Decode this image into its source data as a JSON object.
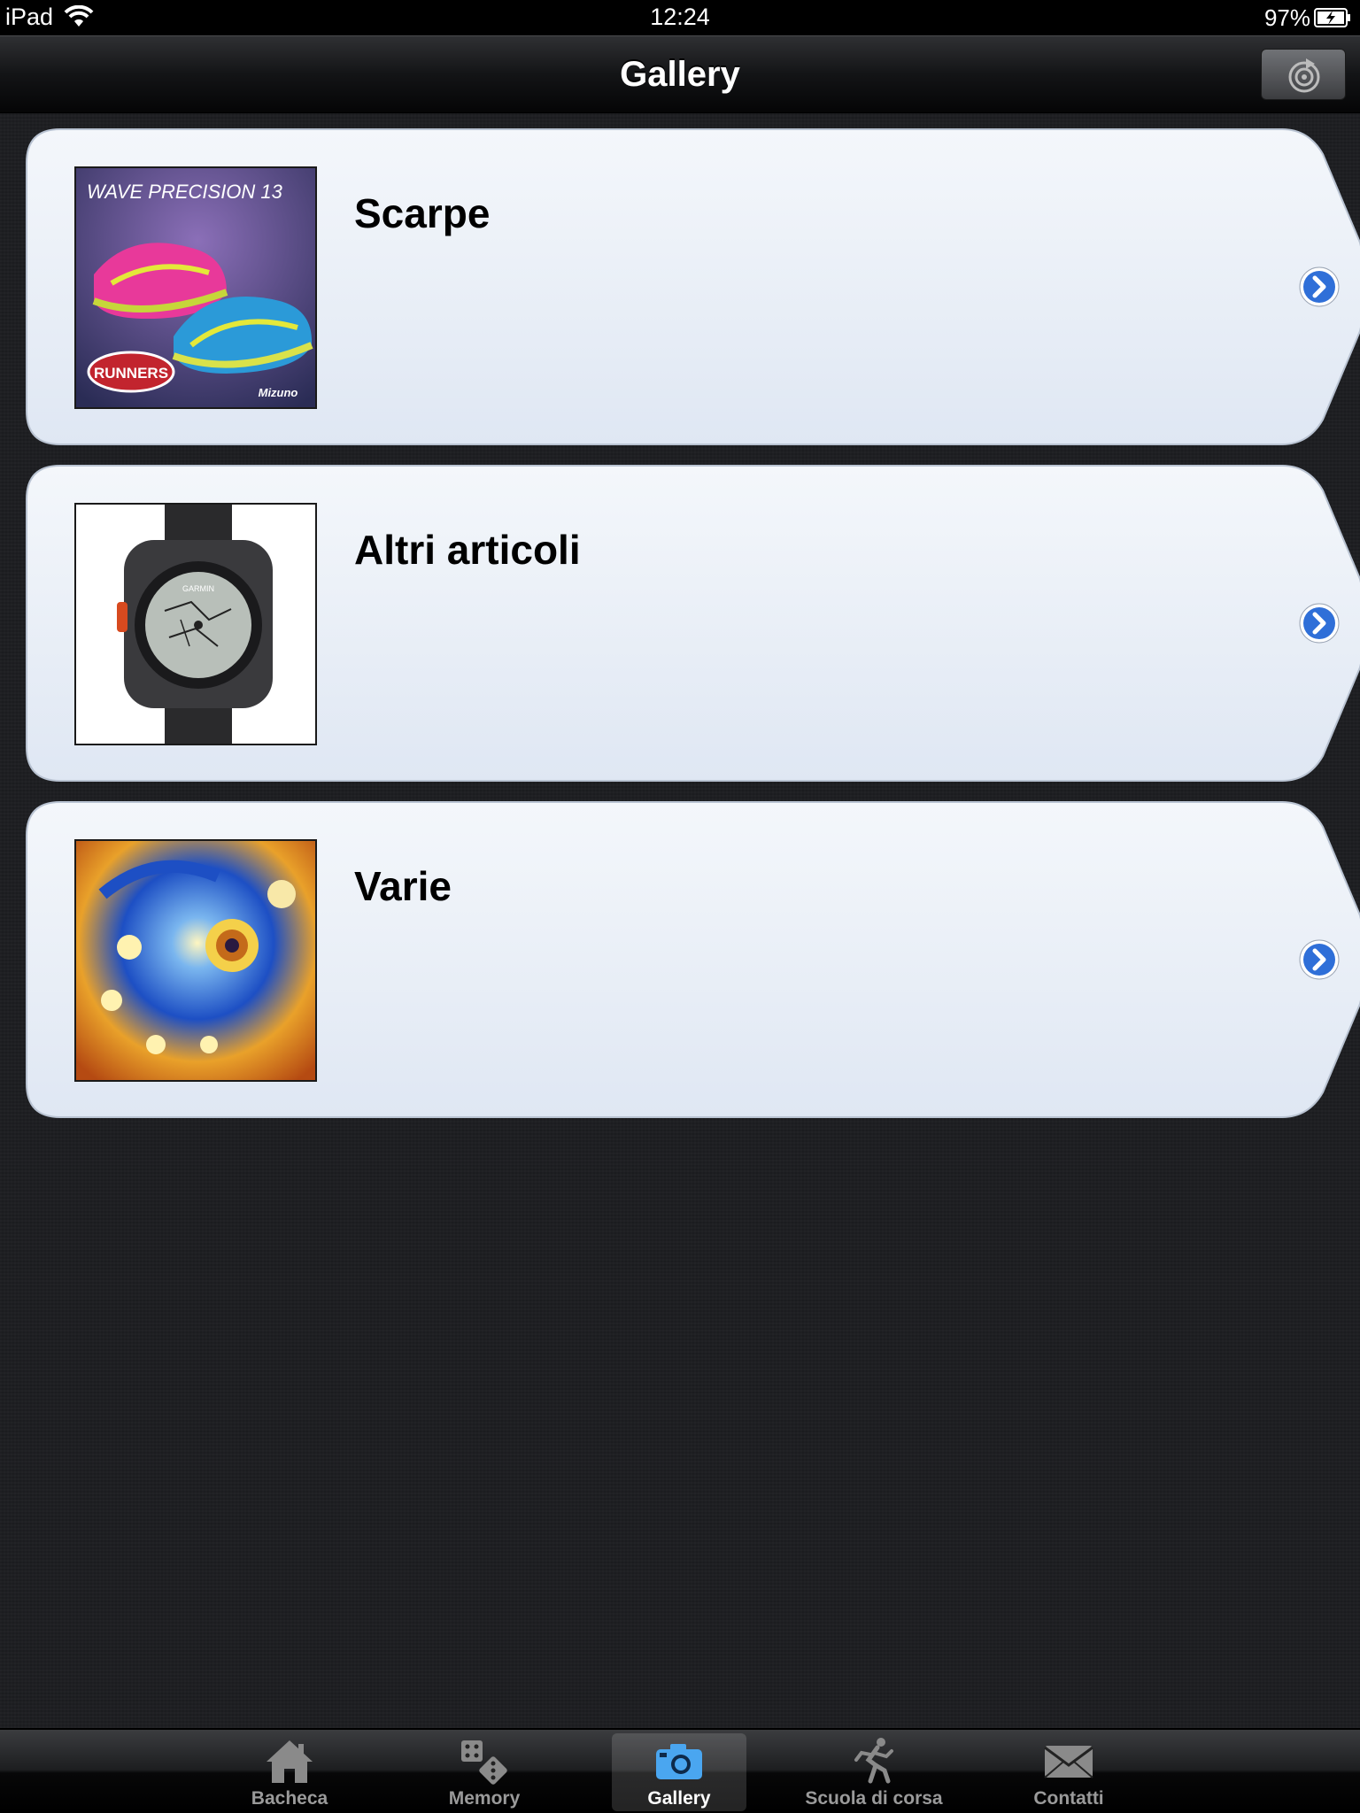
{
  "status_bar": {
    "carrier": "iPad",
    "time": "12:24",
    "battery": "97%"
  },
  "nav_bar": {
    "title": "Gallery",
    "refresh_icon": "refresh-icon"
  },
  "gallery": {
    "items": [
      {
        "title": "Scarpe",
        "thumb_text": "WAVE PRECISION 13",
        "thumb_badge": "RUNNERS",
        "thumb_brand": "Mizuno",
        "icon": "shoes-thumbnail"
      },
      {
        "title": "Altri articoli",
        "thumb_text": "GARMIN",
        "icon": "watch-thumbnail"
      },
      {
        "title": "Varie",
        "icon": "fractal-thumbnail"
      }
    ]
  },
  "tab_bar": {
    "tabs": [
      {
        "label": "Bacheca",
        "icon": "home-icon",
        "active": false
      },
      {
        "label": "Memory",
        "icon": "dice-icon",
        "active": false
      },
      {
        "label": "Gallery",
        "icon": "camera-icon",
        "active": true
      },
      {
        "label": "Scuola di corsa",
        "icon": "runner-icon",
        "active": false
      },
      {
        "label": "Contatti",
        "icon": "envelope-icon",
        "active": false
      }
    ]
  },
  "colors": {
    "background": "#1b1c1f",
    "card": "#e8eef7",
    "accent_blue": "#2f6fd8",
    "tab_active": "#4aa6f0"
  }
}
